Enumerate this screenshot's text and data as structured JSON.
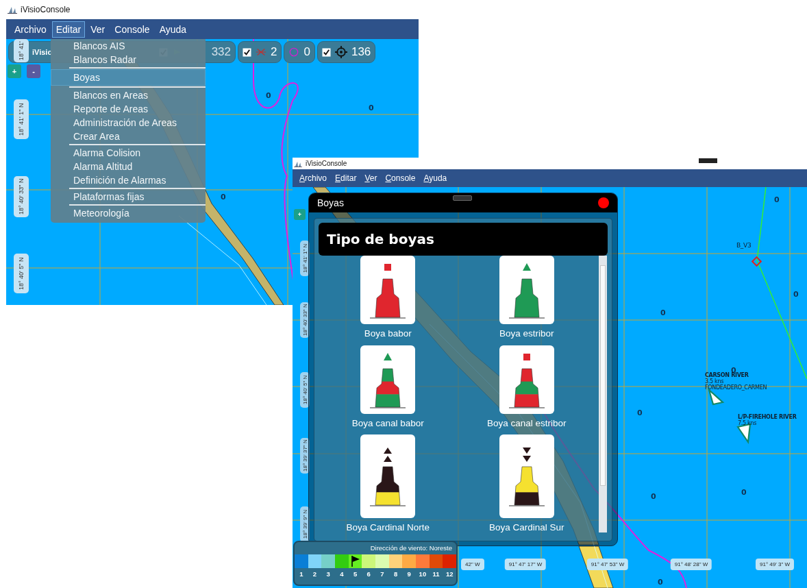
{
  "back_window": {
    "title": "iVisioConsole",
    "menu": [
      {
        "label": "Archivo",
        "selected": false
      },
      {
        "label": "Editar",
        "selected": true
      },
      {
        "label": "Ver",
        "selected": false
      },
      {
        "label": "Console",
        "selected": false
      },
      {
        "label": "Ayuda",
        "selected": false
      }
    ],
    "toolbar": {
      "app_name": "iVisio",
      "ais_checked": true,
      "ais_count": "332",
      "radar_checked": true,
      "radar_count": "2",
      "area_count": "0",
      "buoys_checked": true,
      "buoys_count": "136"
    },
    "edit_menu": [
      [
        {
          "label": "Blancos AIS",
          "selected": false
        },
        {
          "label": "Blancos Radar",
          "selected": false
        }
      ],
      [
        {
          "label": "Boyas",
          "selected": true
        }
      ],
      [
        {
          "label": "Blancos en Areas",
          "selected": false
        },
        {
          "label": "Reporte de Areas",
          "selected": false
        },
        {
          "label": "Administración de Areas",
          "selected": false
        },
        {
          "label": "Crear Area",
          "selected": false
        }
      ],
      [
        {
          "label": "Alarma Colision",
          "selected": false
        },
        {
          "label": "Alarma Altitud",
          "selected": false
        },
        {
          "label": "Definición de Alarmas",
          "selected": false
        }
      ],
      [
        {
          "label": "Plataformas fijas",
          "selected": false
        }
      ],
      [
        {
          "label": "Meteorología",
          "selected": false
        }
      ]
    ],
    "zoom_buttons": [
      "+",
      "-"
    ],
    "lat_labels": [
      "18° 41'",
      "18° 41' 1\" N",
      "18° 40' 33\" N",
      "18° 40' 5\" N"
    ],
    "depths": [
      "0",
      "0",
      "0"
    ]
  },
  "front_window": {
    "title": "iVisioConsole",
    "menu": [
      "Archivo",
      "Editar",
      "Ver",
      "Console",
      "Ayuda"
    ],
    "zoom_button": "+",
    "lat_labels": [
      "18° 41' 1\" N",
      "18° 40' 33\" N",
      "18° 40' 5\" N",
      "18° 39' 37\" N",
      "18° 39' 9\" N"
    ],
    "lon_labels": [
      "42\" W",
      "91° 47' 17\" W",
      "91° 47' 53\" W",
      "91° 48' 28\" W",
      "91° 49' 3\" W"
    ],
    "depths": [
      "0",
      "0",
      "0",
      "0",
      "0",
      "0",
      "0",
      "0"
    ],
    "buoy_marker": {
      "name": "B_V3"
    },
    "vessels": [
      {
        "name": "CARSON RIVER",
        "speed": "3.5 kns",
        "destination": "FONDEADERO_CARMEN"
      },
      {
        "name": "L/P-FIREHOLE RIVER",
        "speed": "7.5 kns"
      }
    ],
    "dialog": {
      "title": "Boyas",
      "heading": "Tipo de boyas",
      "buoys": [
        {
          "label": "Boya babor",
          "kind": "port"
        },
        {
          "label": "Boya estribor",
          "kind": "starboard"
        },
        {
          "label": "Boya canal babor",
          "kind": "channel_port"
        },
        {
          "label": "Boya canal estribor",
          "kind": "channel_starboard"
        },
        {
          "label": "Boya Cardinal Norte",
          "kind": "north"
        },
        {
          "label": "Boya Cardinal Sur",
          "kind": "south"
        }
      ]
    },
    "wind": {
      "title": "Dirección de viento: Noreste",
      "scale": [
        {
          "label": "1",
          "color": "#0a7fd6",
          "selected": false
        },
        {
          "label": "2",
          "color": "#80d4f8",
          "selected": false
        },
        {
          "label": "3",
          "color": "#76d0c8",
          "selected": false
        },
        {
          "label": "4",
          "color": "#33cc11",
          "selected": false
        },
        {
          "label": "5",
          "color": "#66ee22",
          "selected": true
        },
        {
          "label": "6",
          "color": "#ccf77a",
          "selected": false
        },
        {
          "label": "7",
          "color": "#dcfcb0",
          "selected": false
        },
        {
          "label": "8",
          "color": "#ffd27a",
          "selected": false
        },
        {
          "label": "9",
          "color": "#ffaa44",
          "selected": false
        },
        {
          "label": "10",
          "color": "#ff7a3a",
          "selected": false
        },
        {
          "label": "11",
          "color": "#e04a08",
          "selected": false
        },
        {
          "label": "12",
          "color": "#dd2200",
          "selected": false
        }
      ]
    }
  }
}
